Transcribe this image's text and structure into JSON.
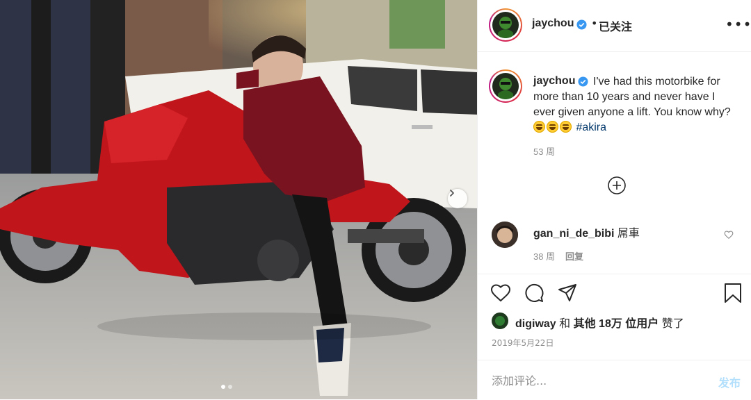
{
  "photo": {
    "alt_icons": [
      "chevron-right-icon"
    ],
    "carousel_total": 2,
    "carousel_current": 1
  },
  "header": {
    "username": "jaychou",
    "separator": "•",
    "follow_status": "已关注",
    "more": "•••"
  },
  "caption": {
    "username": "jaychou",
    "text_before": "I've had this motorbike for more than 10 years and never have I ever given anyone a lift. You know why?",
    "emoji_count": 3,
    "hashtag": "#akira",
    "time": "53 周"
  },
  "comment": {
    "username": "gan_ni_de_bibi",
    "text": "屌車",
    "time": "38 周",
    "reply_label": "回复"
  },
  "likes": {
    "user": "digiway",
    "conj": "和",
    "others": "其他 18万 位用户",
    "suffix": "赞了"
  },
  "date": "2019年5月22日",
  "comment_box": {
    "placeholder": "添加评论...",
    "post_label": "发布"
  },
  "colors": {
    "link": "#00376b",
    "post_disabled": "#b2dffc",
    "verified": "#3897f0",
    "secondary": "#8e8e8e"
  }
}
